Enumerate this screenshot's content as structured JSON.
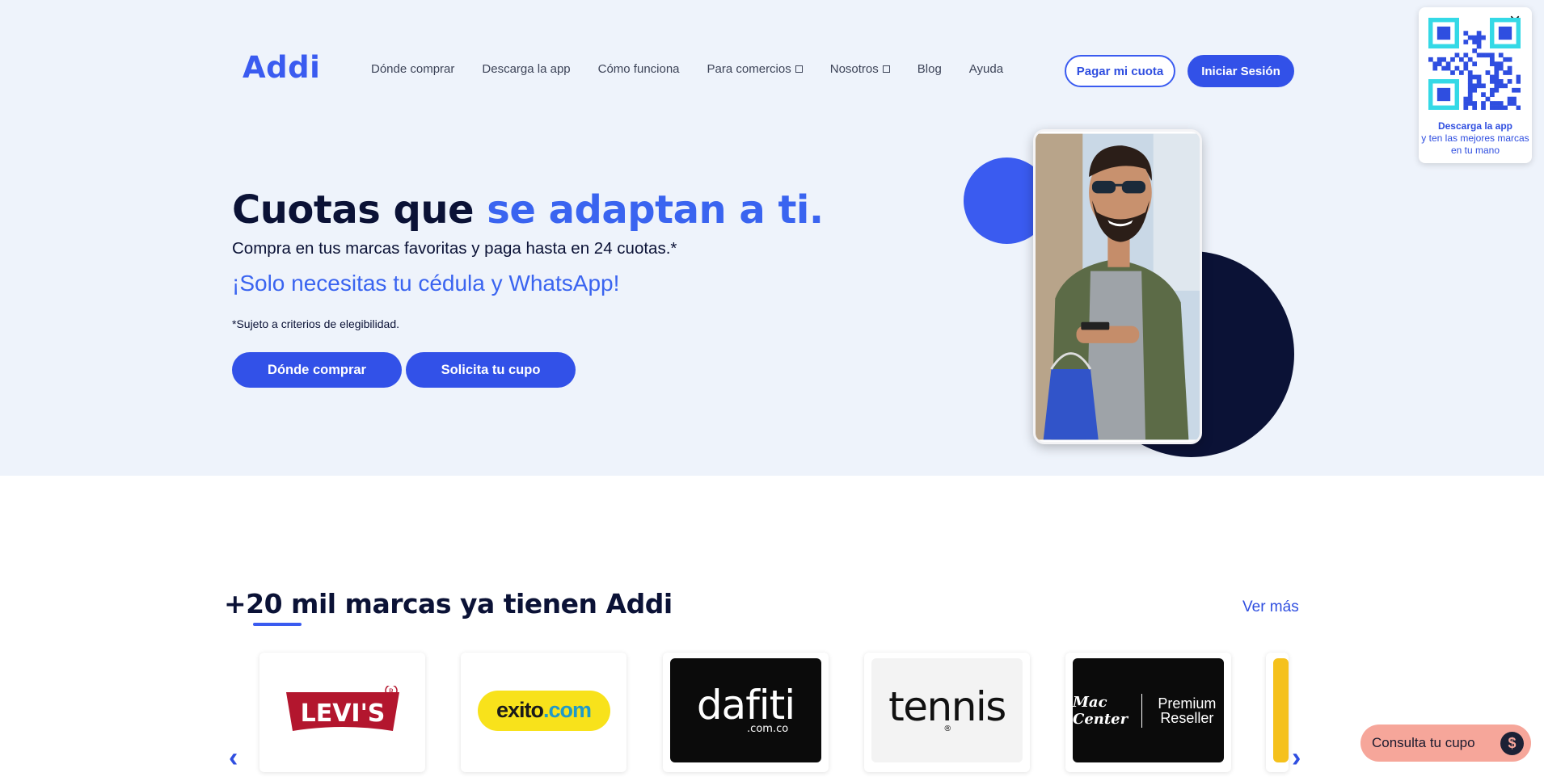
{
  "brand": {
    "logo_text": "Addi",
    "accent": "#3251e8",
    "dark": "#0b1236"
  },
  "nav": {
    "items": [
      {
        "label": "Dónde comprar",
        "has_dropdown": false
      },
      {
        "label": "Descarga la app",
        "has_dropdown": false
      },
      {
        "label": "Cómo funciona",
        "has_dropdown": false
      },
      {
        "label": "Para comercios",
        "has_dropdown": true
      },
      {
        "label": "Nosotros",
        "has_dropdown": true
      },
      {
        "label": "Blog",
        "has_dropdown": false
      },
      {
        "label": "Ayuda",
        "has_dropdown": false
      }
    ],
    "pay_button": "Pagar mi cuota",
    "login_button": "Iniciar Sesión"
  },
  "hero": {
    "headline_dark": "Cuotas que ",
    "headline_blue": "se adaptan a ti.",
    "subtitle": "Compra en tus marcas favoritas y paga hasta en 24 cuotas.*",
    "highlight": "¡Solo necesitas tu cédula y WhatsApp!",
    "disclaimer": "*Sujeto a criterios de elegibilidad.",
    "cta_primary": "Dónde comprar",
    "cta_secondary": "Solicita tu cupo"
  },
  "qr_popup": {
    "title": "Descarga la app",
    "text": "y ten las mejores marcas en tu mano",
    "close_icon": "close-icon"
  },
  "brands_section": {
    "title": "+20 mil marcas ya tienen Addi",
    "see_more": "Ver más",
    "brands": [
      {
        "name": "Levi's",
        "logo_text": "LEVI'S",
        "bg": "#ffffff"
      },
      {
        "name": "Éxito",
        "logo_k": "exito",
        "logo_c": ".com",
        "bg": "#ffffff"
      },
      {
        "name": "Dafiti",
        "logo_text": "dafiti",
        "logo_sub": ".com.co",
        "bg": "#0b0b0b"
      },
      {
        "name": "Tennis",
        "logo_text": "tennis",
        "logo_sub": "®",
        "bg": "#f3f3f3"
      },
      {
        "name": "Mac Center",
        "logo_text": "Mac Center",
        "logo_sub": "Premium Reseller",
        "bg": "#0b0b0b"
      }
    ],
    "prev_icon": "chevron-left-icon",
    "next_icon": "chevron-right-icon"
  },
  "floating": {
    "consulta_label": "Consulta tu cupo",
    "icon": "dollar-icon"
  }
}
